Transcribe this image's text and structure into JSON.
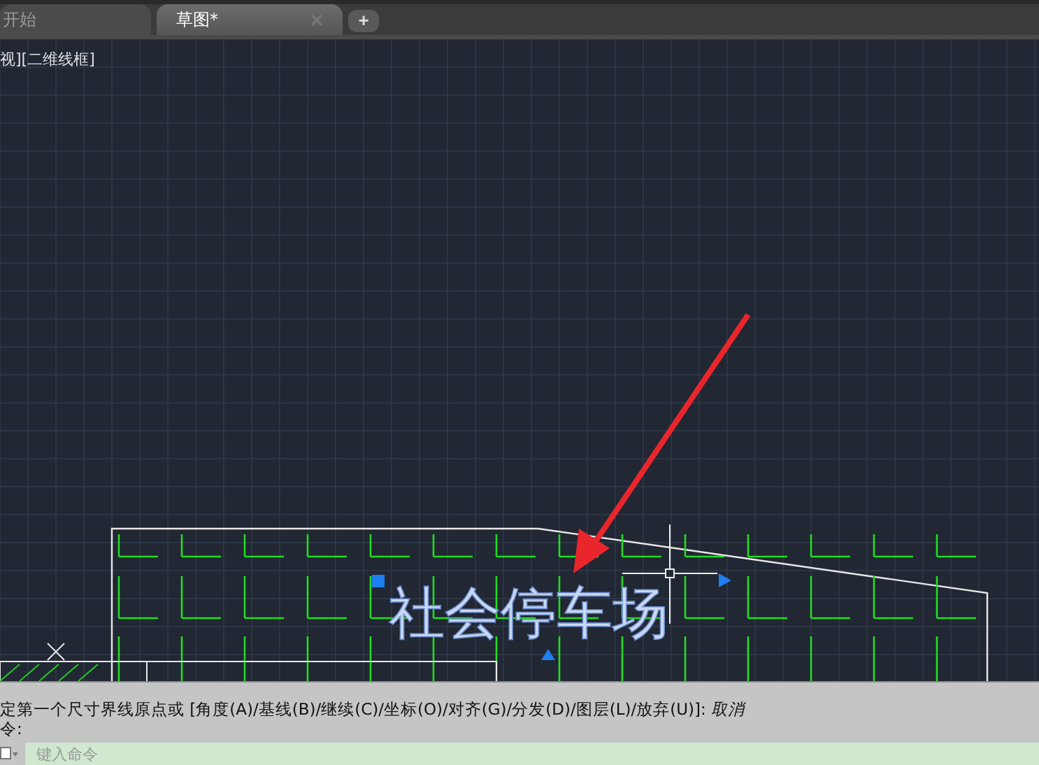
{
  "tabs": [
    {
      "label": "开始",
      "selected": false,
      "closable": false
    },
    {
      "label": "草图*",
      "selected": true,
      "closable": true
    }
  ],
  "new_tab": "+",
  "viewport": {
    "label": "视][二维线框]"
  },
  "drawing": {
    "label": "社会停车场"
  },
  "command_history": [
    "定第一个尺寸界线原点或 [角度(A)/基线(B)/继续(C)/坐标(O)/对齐(G)/分发(D)/图层(L)/放弃(U)]: *取消*",
    "令:"
  ],
  "command_input": {
    "placeholder": "键入命令"
  }
}
